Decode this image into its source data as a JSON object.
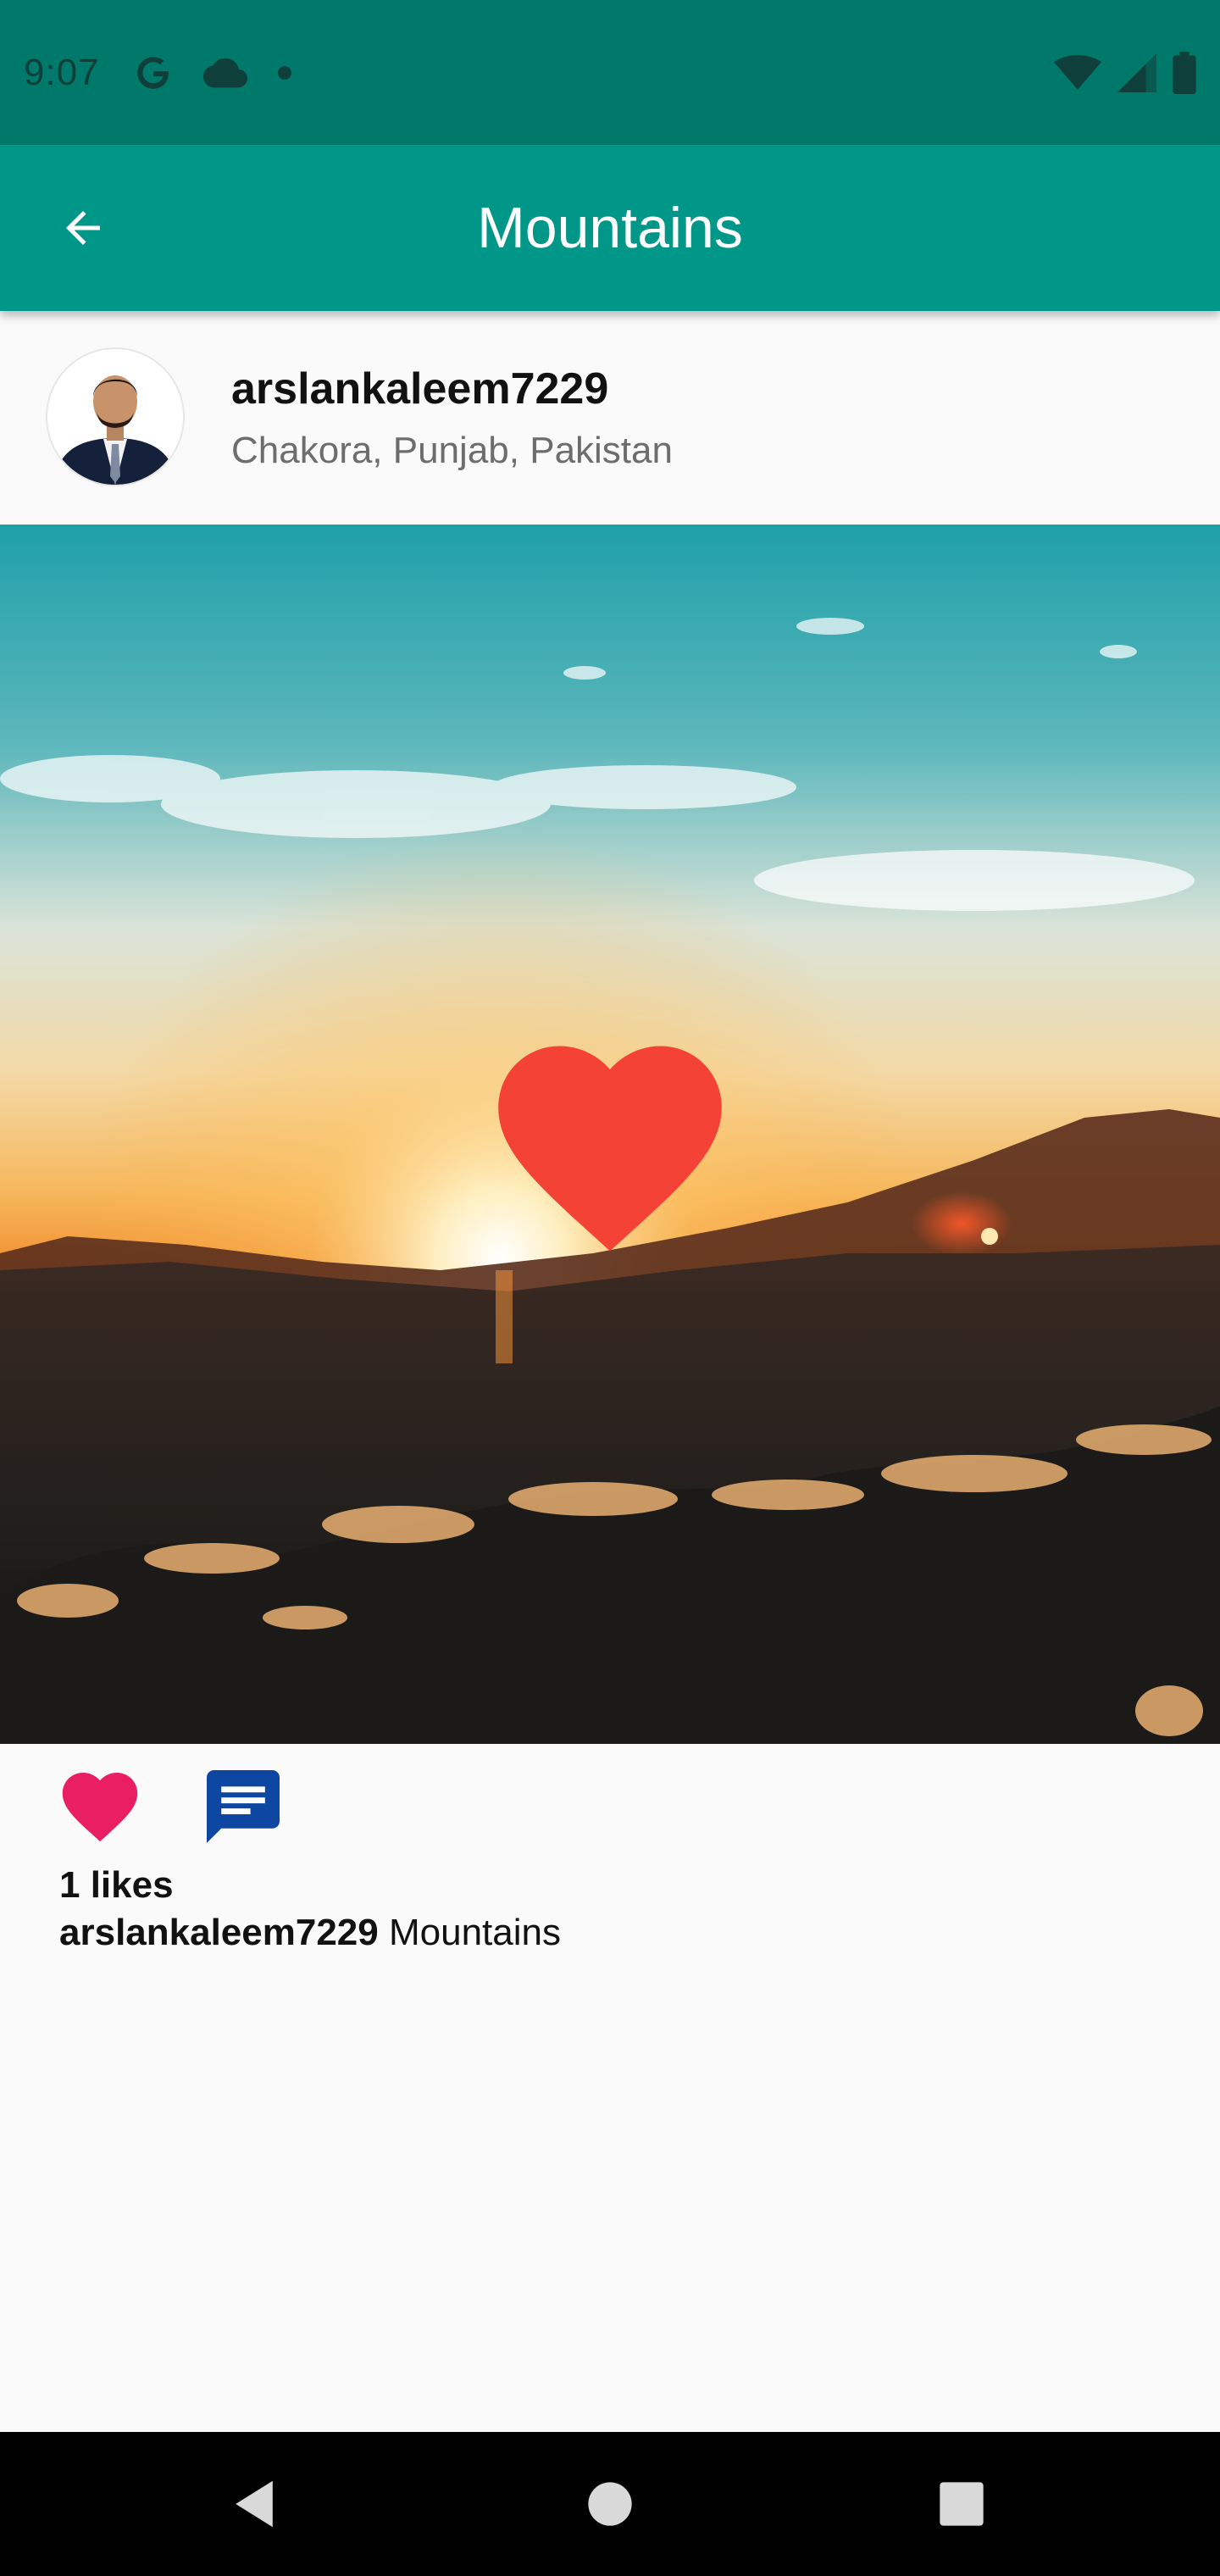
{
  "status_bar": {
    "time": "9:07",
    "left_icons": [
      "google-icon",
      "cloud-icon",
      "dot-icon"
    ],
    "right_icons": [
      "wifi-icon",
      "cellular-signal-icon",
      "battery-icon"
    ]
  },
  "app_bar": {
    "title": "Mountains",
    "back_icon": "arrow-back-icon",
    "color": "#009688",
    "status_color": "#00796b"
  },
  "post": {
    "username": "arslankaleem7229",
    "location": "Chakora, Punjab, Pakistan",
    "image_subject": "sunset over mountains",
    "overlay_icon": "heart-icon",
    "overlay_color": "#f44336",
    "like_icon": "heart-icon",
    "like_color": "#e91e63",
    "comment_icon": "comment-icon",
    "comment_color": "#0d47a1",
    "likes_text": "1 likes",
    "caption_user": "arslankaleem7229",
    "caption_text": "Mountains"
  },
  "nav_bar": {
    "icons": [
      "nav-back-icon",
      "nav-home-icon",
      "nav-recents-icon"
    ]
  }
}
